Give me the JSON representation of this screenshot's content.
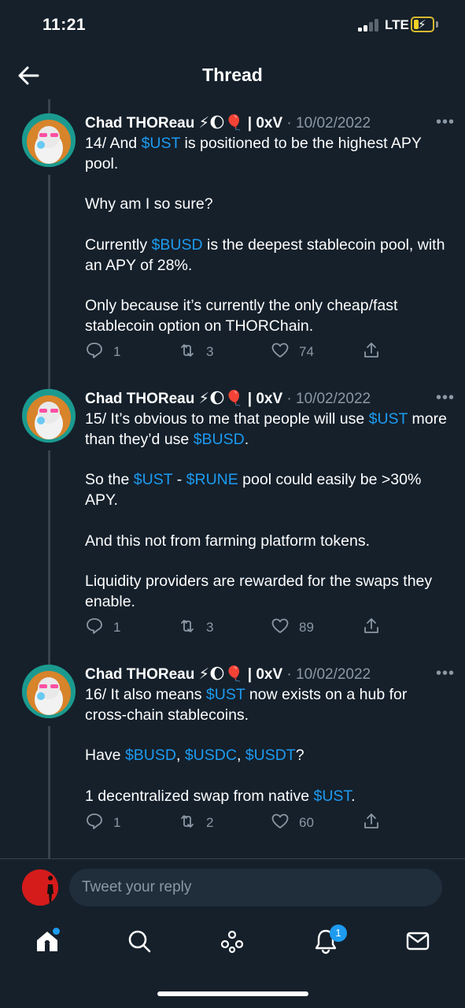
{
  "status_bar": {
    "time": "11:21",
    "network": "LTE"
  },
  "header": {
    "title": "Thread"
  },
  "tweets": [
    {
      "author": "Chad THOReau",
      "emoji": "⚡🌔🎈",
      "handle": "| 0xV",
      "date": "· 10/02/2022",
      "body": [
        [
          {
            "t": "14/ And "
          },
          {
            "t": "$UST",
            "tag": true
          },
          {
            "t": " is positioned to be the highest APY pool."
          }
        ],
        [
          {
            "t": "Why am I so sure?"
          }
        ],
        [
          {
            "t": "Currently "
          },
          {
            "t": "$BUSD",
            "tag": true
          },
          {
            "t": " is the deepest stablecoin pool, with an APY of 28%."
          }
        ],
        [
          {
            "t": "Only because it’s currently the only cheap/fast stablecoin option on THORChain."
          }
        ]
      ],
      "replies": "1",
      "retweets": "3",
      "likes": "74"
    },
    {
      "author": "Chad THOReau",
      "emoji": "⚡🌔🎈",
      "handle": "| 0xV",
      "date": "· 10/02/2022",
      "body": [
        [
          {
            "t": "15/ It’s obvious to me that people will use "
          },
          {
            "t": "$UST",
            "tag": true
          },
          {
            "t": " more than they’d use "
          },
          {
            "t": "$BUSD",
            "tag": true
          },
          {
            "t": "."
          }
        ],
        [
          {
            "t": "So the "
          },
          {
            "t": "$UST",
            "tag": true
          },
          {
            "t": " - "
          },
          {
            "t": "$RUNE",
            "tag": true
          },
          {
            "t": " pool could easily be >30% APY."
          }
        ],
        [
          {
            "t": "And this not from farming platform tokens."
          }
        ],
        [
          {
            "t": "Liquidity providers are rewarded for the swaps they enable."
          }
        ]
      ],
      "replies": "1",
      "retweets": "3",
      "likes": "89"
    },
    {
      "author": "Chad THOReau",
      "emoji": "⚡🌔🎈",
      "handle": "| 0xV",
      "date": "· 10/02/2022",
      "body": [
        [
          {
            "t": "16/ It also means "
          },
          {
            "t": "$UST",
            "tag": true
          },
          {
            "t": " now exists on a hub for cross-chain stablecoins."
          }
        ],
        [
          {
            "t": "Have "
          },
          {
            "t": "$BUSD",
            "tag": true
          },
          {
            "t": ", "
          },
          {
            "t": "$USDC",
            "tag": true
          },
          {
            "t": ", "
          },
          {
            "t": "$USDT",
            "tag": true
          },
          {
            "t": "?"
          }
        ],
        [
          {
            "t": "1 decentralized swap from native "
          },
          {
            "t": "$UST",
            "tag": true
          },
          {
            "t": "."
          }
        ]
      ],
      "replies": "1",
      "retweets": "2",
      "likes": "60"
    }
  ],
  "reply": {
    "placeholder": "Tweet your reply"
  },
  "nav": {
    "notifications_badge": "1"
  },
  "colors": {
    "background": "#15202b",
    "accent": "#1d9bf0",
    "muted": "#8b98a5"
  }
}
